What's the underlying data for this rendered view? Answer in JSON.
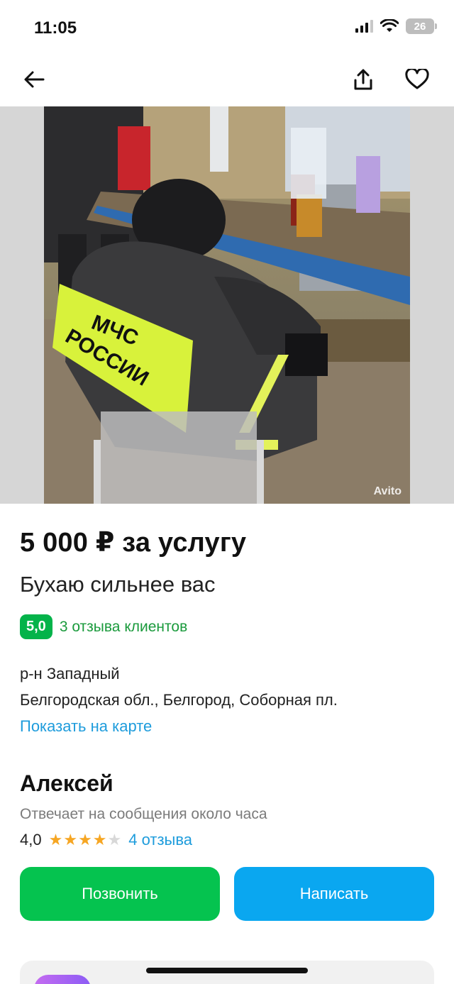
{
  "status_bar": {
    "time": "11:05",
    "battery": "26",
    "icons": [
      "signal-icon",
      "wifi-icon",
      "battery-icon"
    ]
  },
  "nav": {
    "icons": [
      "back-arrow-icon",
      "share-icon",
      "heart-icon"
    ]
  },
  "photo": {
    "watermark": "Avito",
    "vest_text": "МЧС РОССИИ"
  },
  "listing": {
    "price": "5 000 ₽ за услугу",
    "title": "Бухаю сильнее вас",
    "rating": "5,0",
    "reviews_link": "3 отзыва клиентов",
    "district": "р-н Западный",
    "address": "Белгородская обл., Белгород, Соборная пл.",
    "map_link": "Показать на карте"
  },
  "seller": {
    "name": "Алексей",
    "reply_time": "Отвечает на сообщения около часа",
    "score": "4,0",
    "stars_filled": 4,
    "stars_total": 5,
    "reviews": "4 отзыва"
  },
  "actions": {
    "call": "Позвонить",
    "message": "Написать"
  },
  "colors": {
    "green": "#05c34f",
    "blue": "#0aa7f0",
    "link_blue": "#1e9cdc",
    "rating_green": "#04b34a",
    "star": "#f6a623"
  }
}
